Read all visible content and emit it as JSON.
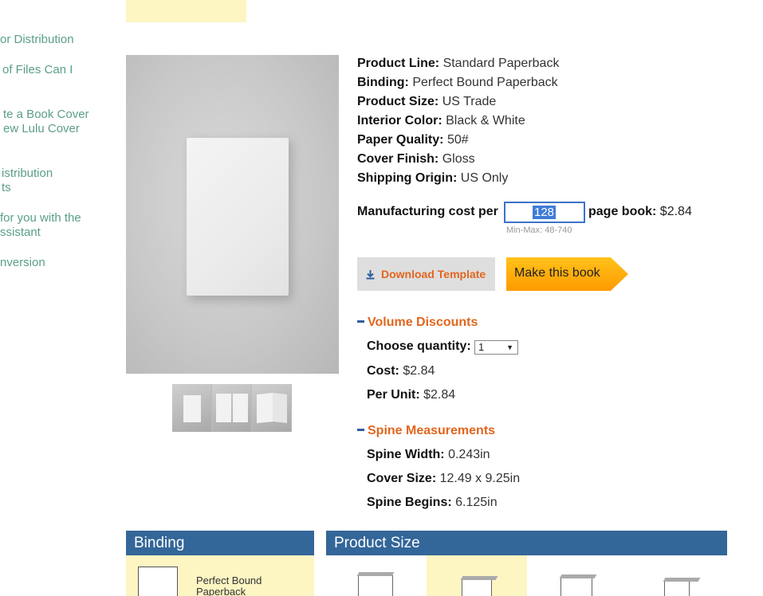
{
  "sidebar": {
    "links": [
      {
        "lines": [
          "or Distribution"
        ]
      },
      {
        "lines": [
          "of Files Can I"
        ]
      },
      {
        "lines": [
          "te a Book Cover",
          "ew Lulu Cover"
        ]
      },
      {
        "lines": [
          "istribution",
          "ts"
        ]
      },
      {
        "lines": [
          "for you with the",
          "ssistant"
        ]
      },
      {
        "lines": [
          "nversion"
        ]
      }
    ]
  },
  "specs": [
    {
      "label": "Product Line:",
      "value": "Standard Paperback"
    },
    {
      "label": "Binding:",
      "value": "Perfect Bound Paperback"
    },
    {
      "label": "Product Size:",
      "value": "US Trade"
    },
    {
      "label": "Interior Color:",
      "value": "Black & White"
    },
    {
      "label": "Paper Quality:",
      "value": "50#"
    },
    {
      "label": "Cover Finish:",
      "value": "Gloss"
    },
    {
      "label": "Shipping Origin:",
      "value": "US Only"
    }
  ],
  "manufacturing": {
    "label_before": "Manufacturing cost per",
    "page_count": "128",
    "label_after": "page book:",
    "cost": "$2.84",
    "minmax": "Min-Max: 48-740"
  },
  "buttons": {
    "download_template": "Download Template",
    "make_book": "Make this book"
  },
  "volume_discounts": {
    "title": "Volume Discounts",
    "choose_quantity_label": "Choose quantity:",
    "quantity_selected": "1",
    "cost_label": "Cost:",
    "cost_value": "$2.84",
    "per_unit_label": "Per Unit:",
    "per_unit_value": "$2.84"
  },
  "spine": {
    "title": "Spine Measurements",
    "spine_width_label": "Spine Width:",
    "spine_width_value": "0.243in",
    "cover_size_label": "Cover Size:",
    "cover_size_value": "12.49 x 9.25in",
    "spine_begins_label": "Spine Begins:",
    "spine_begins_value": "6.125in"
  },
  "binding_panel": {
    "title": "Binding",
    "option_label": "Perfect Bound Paperback"
  },
  "size_panel": {
    "title": "Product Size"
  },
  "colors": {
    "accent_orange": "#e2661e",
    "header_blue": "#336699",
    "highlight_yellow": "#fdf5c2",
    "sidebar_link": "#5a9e8a"
  }
}
